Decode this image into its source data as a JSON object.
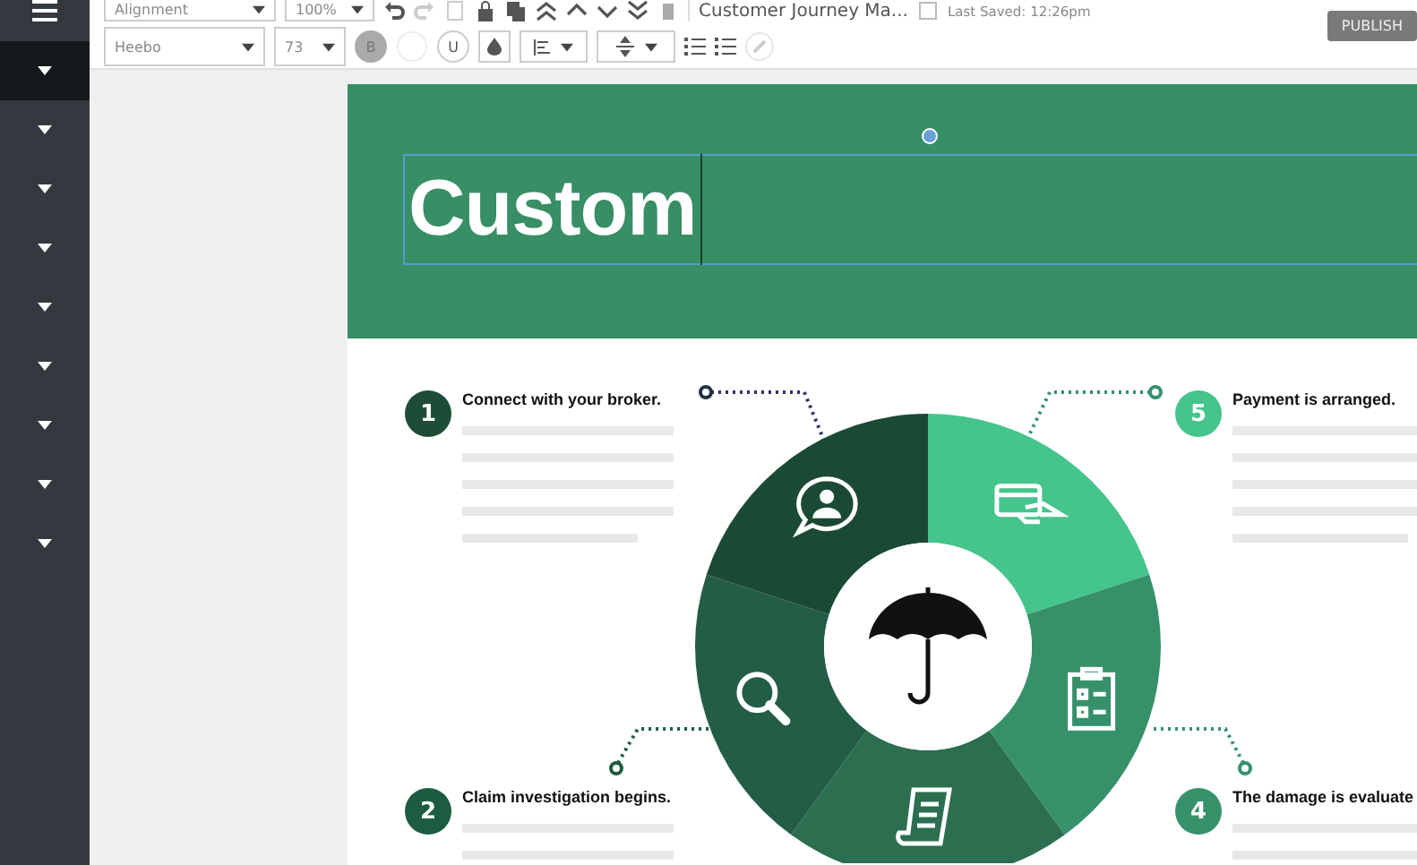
{
  "sidebar": {
    "items": [
      {
        "selected": true
      },
      {
        "selected": false
      },
      {
        "selected": false
      },
      {
        "selected": false
      },
      {
        "selected": false
      },
      {
        "selected": false
      },
      {
        "selected": false
      },
      {
        "selected": false
      },
      {
        "selected": false
      }
    ]
  },
  "toolbar": {
    "alignment": "Alignment",
    "zoom": "100%",
    "document_title": "Customer Journey Ma...",
    "last_saved": "Last Saved: 12:26pm",
    "publish": "PUBLISH",
    "font": "Heebo",
    "font_size": "73",
    "bold": {
      "label": "B",
      "selected": true
    },
    "underline": {
      "label": "U",
      "selected": false
    }
  },
  "header": {
    "title": "Custom"
  },
  "steps": [
    {
      "number": "1",
      "title": "Connect with your broker.",
      "color": "#1d4d36"
    },
    {
      "number": "5",
      "title": "Payment is arranged.",
      "color": "#45c48c"
    },
    {
      "number": "2",
      "title": "Claim investigation begins.",
      "color": "#1d5c40"
    },
    {
      "number": "4",
      "title": "The damage is evaluate",
      "color": "#36916a"
    }
  ],
  "wheel": {
    "segments": [
      {
        "kind": "card",
        "color": "#45c48c"
      },
      {
        "kind": "clipboard",
        "color": "#36916a"
      },
      {
        "kind": "document",
        "color": "#2b6e50"
      },
      {
        "kind": "search",
        "color": "#245d45"
      },
      {
        "kind": "chat",
        "color": "#1b4a34"
      }
    ]
  }
}
